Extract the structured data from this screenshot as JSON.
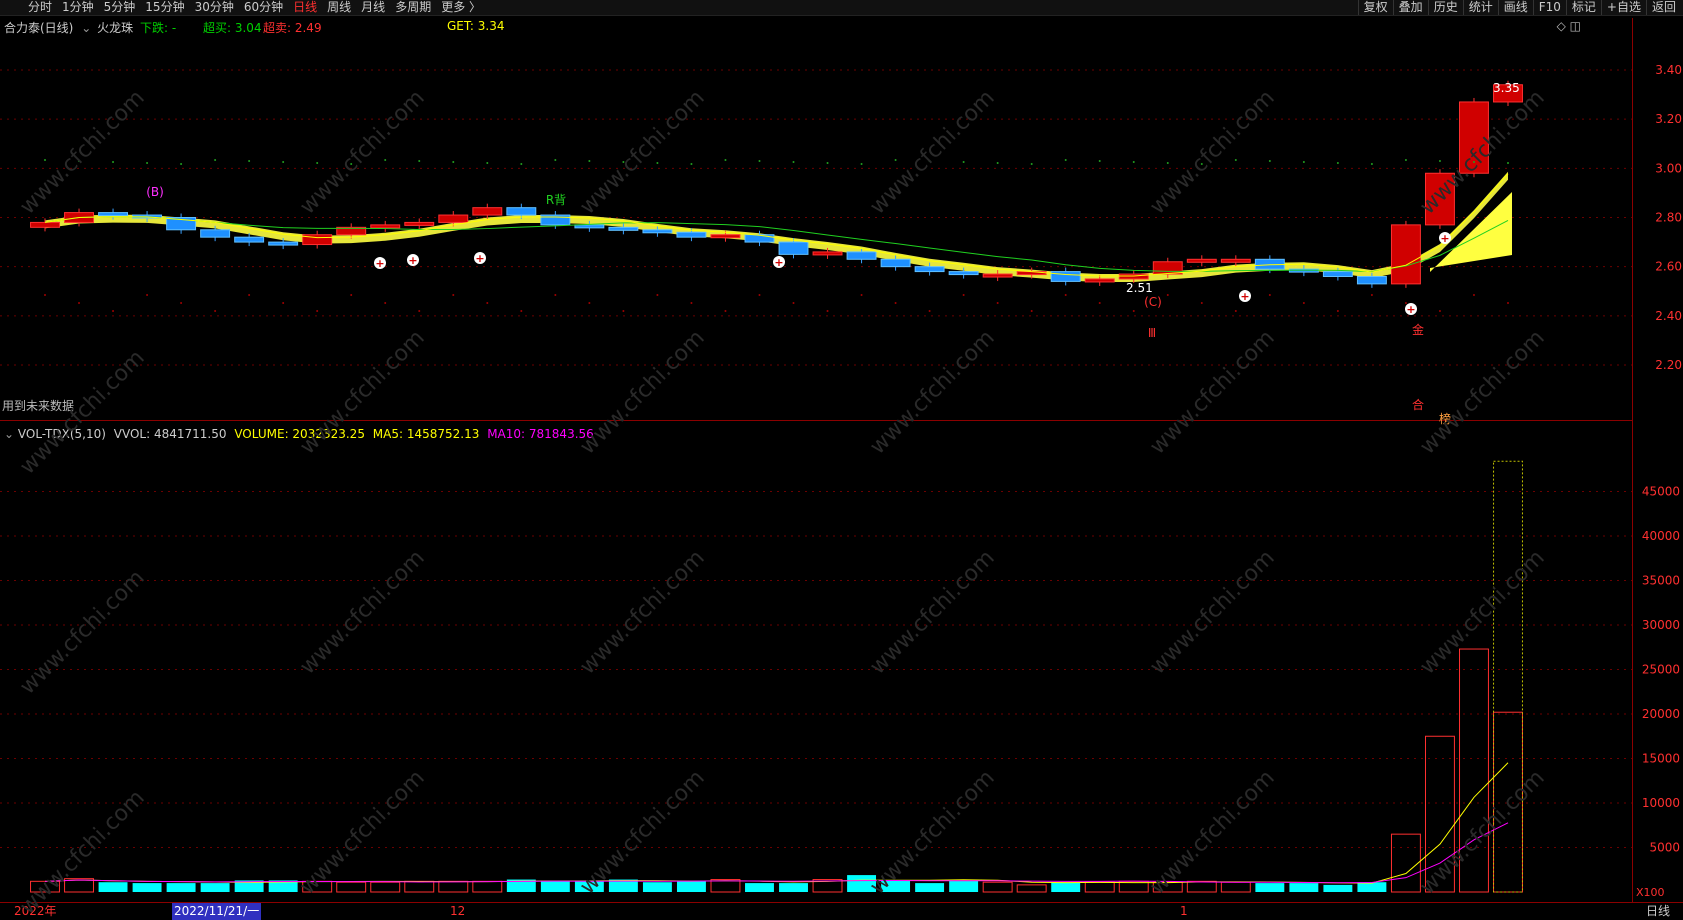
{
  "toolbar": {
    "periods": [
      "分时",
      "1分钟",
      "5分钟",
      "15分钟",
      "30分钟",
      "60分钟",
      "日线",
      "周线",
      "月线",
      "多周期",
      "更多 〉"
    ],
    "active_period": "日线",
    "right_buttons": [
      "复权",
      "叠加",
      "历史",
      "统计",
      "画线",
      "F10",
      "标记",
      "+自选",
      "返回"
    ]
  },
  "main": {
    "stock_title": "合力泰(日线)",
    "indicator_name": "火龙珠",
    "down_label": "下跌: -",
    "overbuy_label": "超买: 3.04",
    "oversell_label": "超卖: 2.49",
    "get_label": "GET: 3.34",
    "future_data_note": "用到未来数据",
    "marker_b": "(B)",
    "marker_r": "R背",
    "marker_c": "(C)",
    "marker_iii": "Ⅲ",
    "marker_jin": "金",
    "marker_he": "合",
    "marker_bang": "榜",
    "low_label": "2.51",
    "high_label": "3.35",
    "y_ticks": [
      "3.40",
      "3.20",
      "3.00",
      "2.80",
      "2.60",
      "2.40",
      "2.20"
    ]
  },
  "volume": {
    "indicator": "VOL-TDX(5,10)",
    "vvol": "VVOL: 4841711.50",
    "volume": "VOLUME: 2032323.25",
    "ma5": "MA5: 1458752.13",
    "ma10": "MA10: 781843.56",
    "y_ticks": [
      "45000",
      "40000",
      "35000",
      "30000",
      "25000",
      "20000",
      "15000",
      "10000",
      "5000"
    ],
    "unit": "X100"
  },
  "bottom": {
    "labels": [
      "2022年",
      "2022/11/21/一",
      "12",
      "1"
    ],
    "period": "日线"
  },
  "colors": {
    "up": "#ff2020",
    "down": "#00ffff",
    "ma5": "#ffff00",
    "ma10": "#ff00ff"
  },
  "chart_data": {
    "type": "bar",
    "title": "合力泰(日线)",
    "price_ylim": [
      2.0,
      3.45
    ],
    "candles_close_approx": [
      2.78,
      2.82,
      2.81,
      2.8,
      2.75,
      2.72,
      2.7,
      2.69,
      2.73,
      2.76,
      2.77,
      2.78,
      2.81,
      2.84,
      2.81,
      2.77,
      2.76,
      2.75,
      2.74,
      2.72,
      2.73,
      2.7,
      2.65,
      2.66,
      2.63,
      2.6,
      2.58,
      2.57,
      2.57,
      2.58,
      2.54,
      2.55,
      2.57,
      2.62,
      2.63,
      2.63,
      2.59,
      2.58,
      2.56,
      2.53,
      2.77,
      2.98,
      3.27,
      3.34
    ],
    "volume_ylim": [
      0,
      50000
    ],
    "volume_values": [
      1200,
      1500,
      1100,
      1000,
      1000,
      1000,
      1300,
      1300,
      1200,
      1100,
      1100,
      1200,
      1200,
      1200,
      1400,
      1200,
      1200,
      1400,
      1100,
      1200,
      1400,
      1000,
      1000,
      1400,
      1900,
      1300,
      1000,
      1300,
      1100,
      800,
      1100,
      1100,
      1200,
      1100,
      1200,
      1100,
      1000,
      1000,
      800,
      1100,
      6500,
      17500,
      27300,
      20200
    ]
  }
}
